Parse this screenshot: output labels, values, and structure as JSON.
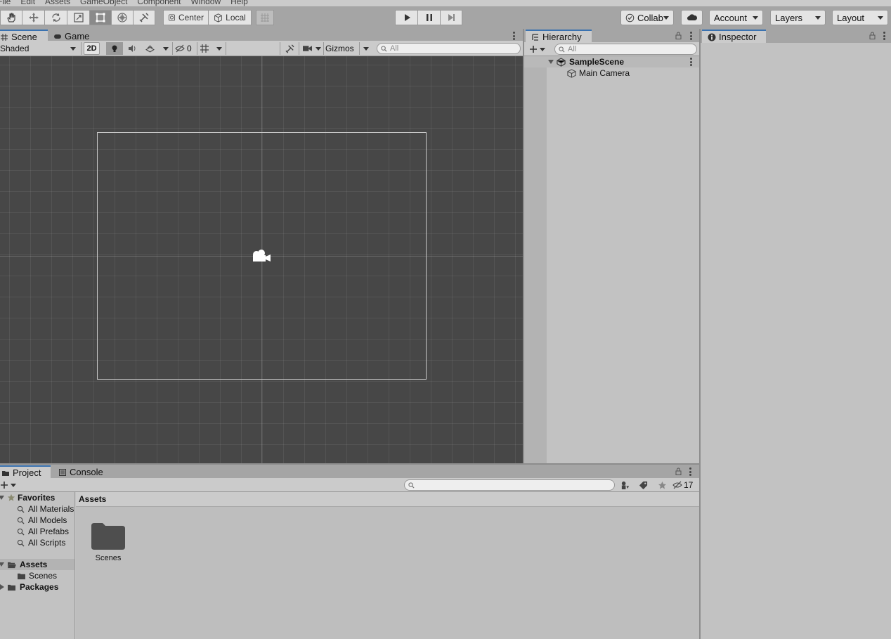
{
  "menu": [
    "File",
    "Edit",
    "Assets",
    "GameObject",
    "Component",
    "Window",
    "Help"
  ],
  "toolbar": {
    "pivot_label": "Center",
    "space_label": "Local",
    "collab_label": "Collab",
    "account_label": "Account",
    "layers_label": "Layers",
    "layout_label": "Layout"
  },
  "scene": {
    "tabs": [
      "Scene",
      "Game"
    ],
    "shading_mode": "Shaded",
    "mode_2d": "2D",
    "hidden_count": "0",
    "gizmos_label": "Gizmos",
    "search_placeholder": "All"
  },
  "hierarchy": {
    "tab": "Hierarchy",
    "search_placeholder": "All",
    "scene_name": "SampleScene",
    "objects": [
      "Main Camera"
    ]
  },
  "inspector": {
    "tab": "Inspector"
  },
  "project": {
    "tabs": [
      "Project",
      "Console"
    ],
    "hidden_packages_count": "17",
    "favorites_label": "Favorites",
    "favorites": [
      "All Materials",
      "All Models",
      "All Prefabs",
      "All Scripts"
    ],
    "assets_label": "Assets",
    "asset_folders": [
      "Scenes"
    ],
    "packages_label": "Packages",
    "breadcrumb": "Assets",
    "content_items": [
      "Scenes"
    ]
  },
  "colors": {
    "window_bg": "#a5a5a5",
    "panel_bg": "#c2c2c2",
    "scene_bg": "#474747",
    "selected_tab_accent": "#3a72b0"
  }
}
